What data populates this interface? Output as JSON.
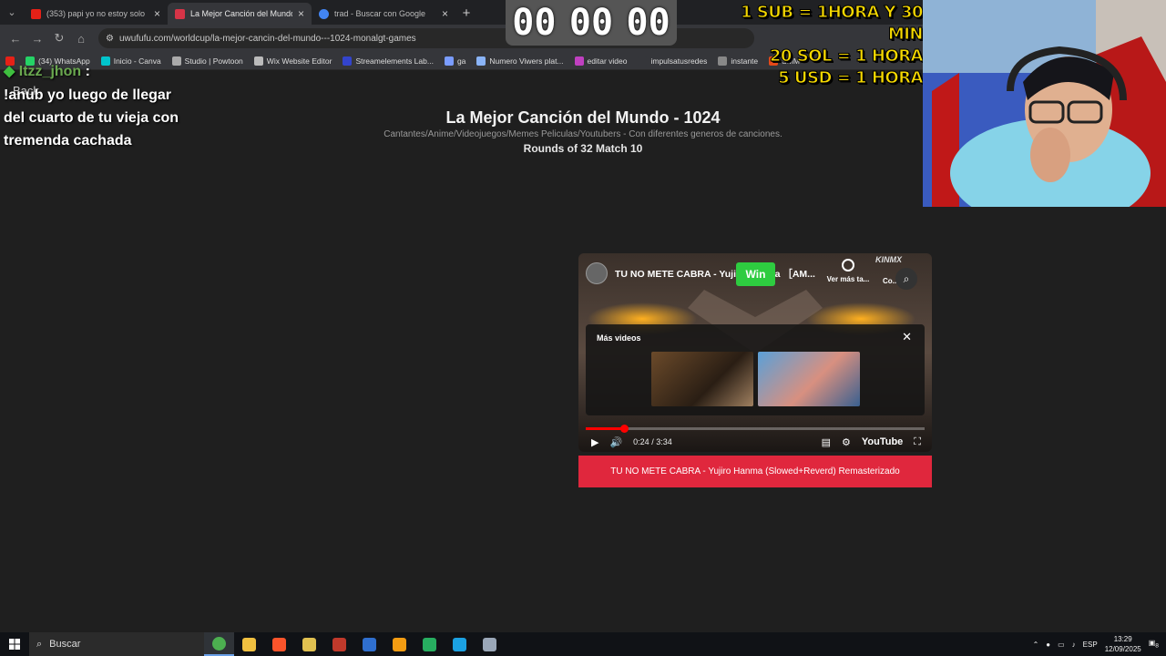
{
  "browser": {
    "tabs": [
      {
        "title": "(353) papi yo no estoy solo",
        "color": "#e62117"
      },
      {
        "title": "La Mejor Canción del Mundo",
        "color": "#d63447",
        "active": true
      },
      {
        "title": "trad - Buscar con Google",
        "color": "#4285f4"
      }
    ],
    "new_tab": "+",
    "url": "uwufufu.com/worldcup/la-mejor-cancin-del-mundo---1024-monalgt-games",
    "bookmarks": [
      {
        "label": "",
        "color": "#e62117"
      },
      {
        "label": "(34) WhatsApp",
        "color": "#25d366"
      },
      {
        "label": "Inicio - Canva",
        "color": "#00c4cc"
      },
      {
        "label": "Studio | Powtoon",
        "color": "#aaaaaa"
      },
      {
        "label": "Wix Website Editor",
        "color": "#bbbbbb"
      },
      {
        "label": "Streamelements Lab...",
        "color": "#3344cc"
      },
      {
        "label": "ga",
        "color": "#7a9cff"
      },
      {
        "label": "Numero Viwers plat...",
        "color": "#8ab4f8"
      },
      {
        "label": "editar video",
        "color": "#c040c0"
      },
      {
        "label": "impulsatusredes",
        "color": "#35363a"
      },
      {
        "label": "instante",
        "color": "#888888"
      },
      {
        "label": "SMM",
        "color": "#e64a19"
      }
    ]
  },
  "overlay": {
    "timer": [
      "00",
      "00",
      "00"
    ],
    "promo": [
      "1 SUB = 1HORA Y 30 MIN",
      "20 SOL = 1 HORA",
      "5 USD = 1 HORA"
    ],
    "chat_user": "Itzz_jhon",
    "chat_sep": ":",
    "chat_message": "!anub yo luego de llegar del cuarto de tu vieja con tremenda cachada",
    "back_link": "Back"
  },
  "page": {
    "title": "La Mejor Canción del Mundo - 1024",
    "subtitle": "Cantantes/Anime/Videojuegos/Memes Peliculas/Youtubers - Con diferentes generos de canciones.",
    "round": "Rounds of 32 Match 10",
    "win_label": "Win",
    "song_button": "TU NO METE CABRA - Yujiro Hanma (Slowed+Reverd) Remasterizado"
  },
  "player": {
    "video_title": "TU NO METE CABRA - Yujiro Hanma ［AM...",
    "watch_later": "Ver más ta...",
    "share": "Co...",
    "more_videos": "Más videos",
    "time": "0:24 / 3:34",
    "progress": 0.112,
    "logo": "YouTube"
  },
  "taskbar": {
    "search_placeholder": "Buscar",
    "apps": [
      {
        "name": "chrome",
        "color": "#4caf50",
        "active": true
      },
      {
        "name": "file-explorer",
        "color": "#f0c040"
      },
      {
        "name": "brave",
        "color": "#fb542b"
      },
      {
        "name": "app-4",
        "color": "#e0c050"
      },
      {
        "name": "app-5",
        "color": "#c0392b"
      },
      {
        "name": "app-6",
        "color": "#2f6fcf"
      },
      {
        "name": "app-7",
        "color": "#f39c12"
      },
      {
        "name": "app-8",
        "color": "#27ae60"
      },
      {
        "name": "app-9",
        "color": "#1ba1e2"
      },
      {
        "name": "app-10",
        "color": "#9aa7b8"
      }
    ],
    "language": "ESP",
    "time": "13:29",
    "date": "12/09/2025",
    "notifications": "8"
  }
}
